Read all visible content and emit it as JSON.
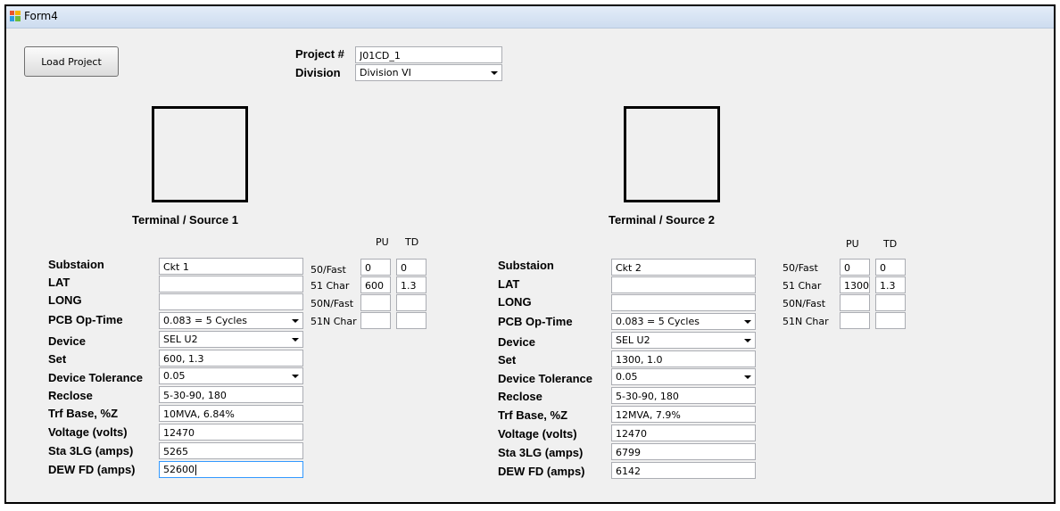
{
  "window": {
    "title": "Form4"
  },
  "toolbar": {
    "load_label": "Load Project"
  },
  "project": {
    "number_label": "Project #",
    "number_value": "J01CD_1",
    "division_label": "Division",
    "division_value": "Division VI"
  },
  "relay_headers": {
    "pu": "PU",
    "td": "TD"
  },
  "relay_labels": {
    "fast50": "50/Fast",
    "char51": "51 Char",
    "fast50n": "50N/Fast",
    "char51n": "51N Char"
  },
  "labels": {
    "substation": "Substaion",
    "lat": "LAT",
    "long": "LONG",
    "pcb": "PCB Op-Time",
    "device": "Device",
    "set": "Set",
    "tolerance": "Device Tolerance",
    "reclose": "Reclose",
    "trf": "Trf Base, %Z",
    "voltage": "Voltage (volts)",
    "sta3lg": "Sta 3LG (amps)",
    "dewfd": "DEW FD (amps)"
  },
  "terminals": [
    {
      "title": "Terminal / Source 1",
      "substation": "Ckt 1",
      "lat": "",
      "long": "",
      "pcb": "0.083 = 5 Cycles",
      "device": "SEL U2",
      "set": "600, 1.3",
      "tolerance": "0.05",
      "reclose": "5-30-90, 180",
      "trf": "10MVA, 6.84%",
      "voltage": "12470",
      "sta3lg": "5265",
      "dewfd": "52600",
      "relay": {
        "fast50_pu": "0",
        "fast50_td": "0",
        "char51_pu": "600",
        "char51_td": "1.3",
        "fast50n_pu": "",
        "fast50n_td": "",
        "char51n_pu": "",
        "char51n_td": ""
      }
    },
    {
      "title": "Terminal / Source 2",
      "substation": "Ckt 2",
      "lat": "",
      "long": "",
      "pcb": "0.083 = 5 Cycles",
      "device": "SEL U2",
      "set": "1300, 1.0",
      "tolerance": "0.05",
      "reclose": "5-30-90, 180",
      "trf": "12MVA, 7.9%",
      "voltage": "12470",
      "sta3lg": "6799",
      "dewfd": "6142",
      "relay": {
        "fast50_pu": "0",
        "fast50_td": "0",
        "char51_pu": "1300",
        "char51_td": "1.3",
        "fast50n_pu": "",
        "fast50n_td": "",
        "char51n_pu": "",
        "char51n_td": ""
      }
    }
  ]
}
